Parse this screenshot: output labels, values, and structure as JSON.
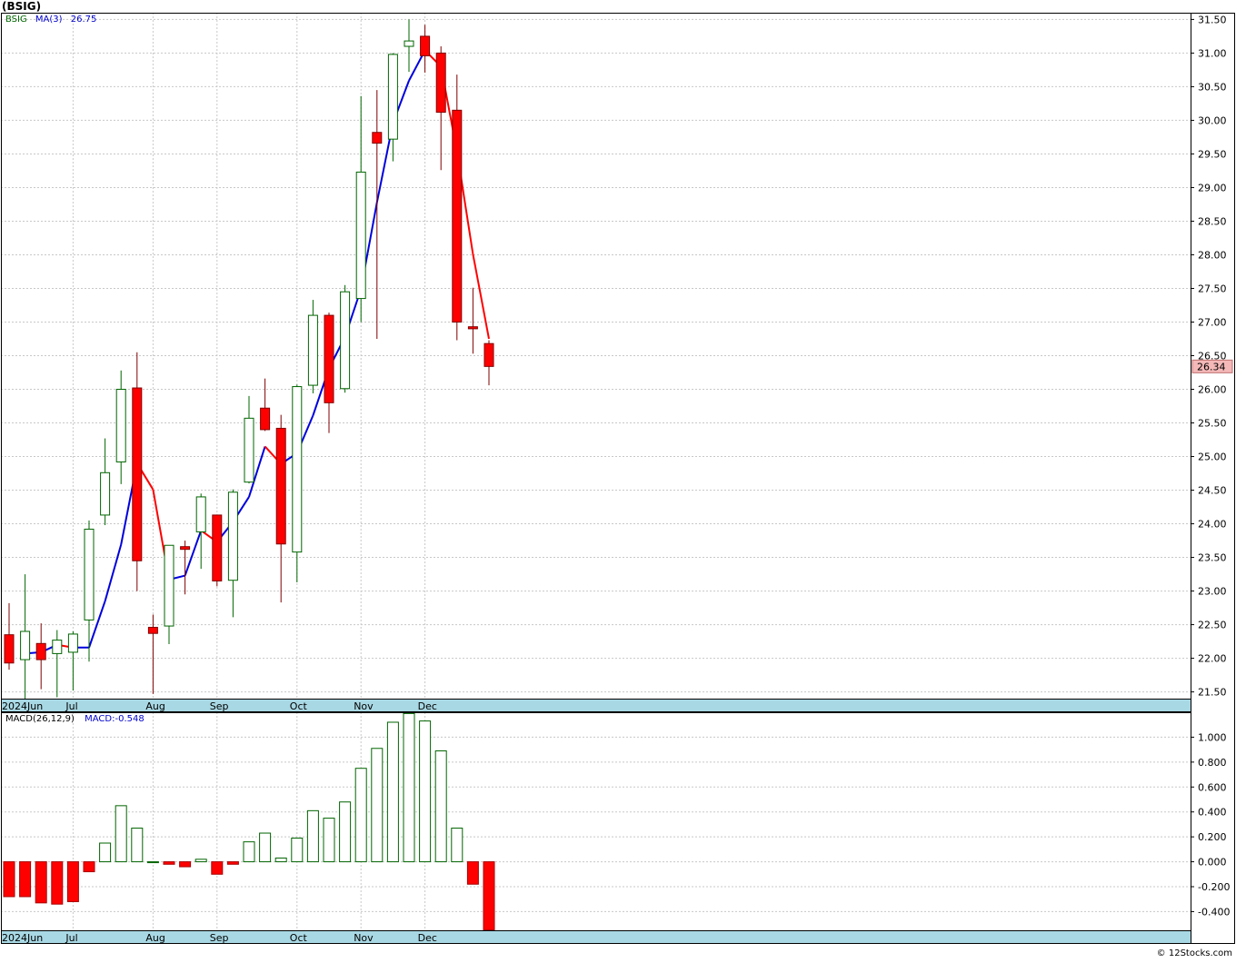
{
  "title": "(BSIG)",
  "legend": {
    "symbol": "BSIG",
    "ma_label": "MA(3)",
    "ma_value": "26.75",
    "macd_label": "MACD(26,12,9)",
    "macd_value": "MACD:-0.548"
  },
  "last_price_label": "26.34",
  "watermark": "© 12Stocks.com",
  "colors": {
    "up": "#006400",
    "down": "#ff0000",
    "ma_up": "#0000dd",
    "ma_down": "#ff0000",
    "axis_band": "#a8d8e4",
    "price_flag_bg": "#f4b8b8"
  },
  "chart_data": [
    {
      "type": "candlestick",
      "name": "price",
      "ylim": [
        21.4,
        31.6
      ],
      "yticks": [
        "21.50",
        "22.00",
        "22.50",
        "23.00",
        "23.50",
        "24.00",
        "24.50",
        "25.00",
        "25.50",
        "26.00",
        "26.50",
        "27.00",
        "27.50",
        "28.00",
        "28.50",
        "29.00",
        "29.50",
        "30.00",
        "30.50",
        "31.00",
        "31.50"
      ],
      "x_labels": [
        "2024Jun",
        "Jul",
        "Aug",
        "Sep",
        "Oct",
        "Nov",
        "Dec"
      ],
      "x_label_weeks": [
        0,
        4,
        9,
        13,
        18,
        22,
        26
      ],
      "candles": [
        {
          "o": 22.35,
          "h": 22.82,
          "l": 21.83,
          "c": 21.93
        },
        {
          "o": 21.98,
          "h": 23.25,
          "l": 21.4,
          "c": 22.4
        },
        {
          "o": 22.22,
          "h": 22.52,
          "l": 21.54,
          "c": 21.98
        },
        {
          "o": 22.07,
          "h": 22.42,
          "l": 21.42,
          "c": 22.27
        },
        {
          "o": 22.09,
          "h": 22.4,
          "l": 21.52,
          "c": 22.36
        },
        {
          "o": 22.57,
          "h": 24.05,
          "l": 21.95,
          "c": 23.92
        },
        {
          "o": 24.13,
          "h": 25.27,
          "l": 23.98,
          "c": 24.76
        },
        {
          "o": 24.92,
          "h": 26.28,
          "l": 24.59,
          "c": 26.0
        },
        {
          "o": 26.02,
          "h": 26.55,
          "l": 23.0,
          "c": 23.45
        },
        {
          "o": 22.46,
          "h": 22.65,
          "l": 21.47,
          "c": 22.37
        },
        {
          "o": 22.48,
          "h": 23.68,
          "l": 22.21,
          "c": 23.68
        },
        {
          "o": 23.66,
          "h": 23.75,
          "l": 22.95,
          "c": 23.62
        },
        {
          "o": 23.88,
          "h": 24.45,
          "l": 23.33,
          "c": 24.4
        },
        {
          "o": 24.13,
          "h": 24.13,
          "l": 23.07,
          "c": 23.15
        },
        {
          "o": 23.16,
          "h": 24.51,
          "l": 22.61,
          "c": 24.47
        },
        {
          "o": 24.62,
          "h": 25.9,
          "l": 24.6,
          "c": 25.57
        },
        {
          "o": 25.72,
          "h": 26.16,
          "l": 25.38,
          "c": 25.4
        },
        {
          "o": 25.42,
          "h": 25.62,
          "l": 22.83,
          "c": 23.7
        },
        {
          "o": 23.58,
          "h": 26.07,
          "l": 23.13,
          "c": 26.04
        },
        {
          "o": 26.06,
          "h": 27.33,
          "l": 25.94,
          "c": 27.1
        },
        {
          "o": 27.1,
          "h": 27.14,
          "l": 25.35,
          "c": 25.8
        },
        {
          "o": 26.01,
          "h": 27.55,
          "l": 25.95,
          "c": 27.45
        },
        {
          "o": 27.35,
          "h": 30.36,
          "l": 27.0,
          "c": 29.23
        },
        {
          "o": 29.82,
          "h": 30.45,
          "l": 26.75,
          "c": 29.66
        },
        {
          "o": 29.72,
          "h": 31.0,
          "l": 29.39,
          "c": 30.98
        },
        {
          "o": 31.1,
          "h": 31.5,
          "l": 30.72,
          "c": 31.18
        },
        {
          "o": 31.25,
          "h": 31.42,
          "l": 30.71,
          "c": 30.96
        },
        {
          "o": 31.0,
          "h": 31.1,
          "l": 29.26,
          "c": 30.12
        },
        {
          "o": 30.15,
          "h": 30.68,
          "l": 26.73,
          "c": 27.0
        },
        {
          "o": 26.93,
          "h": 27.51,
          "l": 26.53,
          "c": 26.9
        },
        {
          "o": 26.68,
          "h": 26.73,
          "l": 26.06,
          "c": 26.34
        }
      ],
      "ma3": [
        null,
        22.07,
        22.09,
        22.2,
        22.16,
        22.16,
        22.85,
        23.69,
        24.9,
        24.51,
        23.17,
        23.23,
        23.9,
        23.73,
        24.03,
        24.4,
        25.15,
        24.89,
        25.05,
        25.61,
        26.31,
        26.78,
        27.49,
        28.78,
        29.96,
        30.59,
        31.04,
        30.8,
        29.54,
        28.01,
        26.75
      ]
    },
    {
      "type": "bar",
      "name": "MACD",
      "ylim": [
        -0.55,
        1.2
      ],
      "yticks": [
        "-0.400",
        "-0.200",
        "0.000",
        "0.200",
        "0.400",
        "0.600",
        "0.800",
        "1.000"
      ],
      "x_labels": [
        "2024Jun",
        "Jul",
        "Aug",
        "Sep",
        "Oct",
        "Nov",
        "Dec"
      ],
      "values": [
        -0.28,
        -0.28,
        -0.33,
        -0.34,
        -0.32,
        -0.08,
        0.15,
        0.45,
        0.27,
        0.0,
        -0.02,
        -0.04,
        0.02,
        -0.1,
        -0.02,
        0.16,
        0.23,
        0.03,
        0.19,
        0.41,
        0.35,
        0.48,
        0.75,
        0.91,
        1.12,
        1.19,
        1.13,
        0.89,
        0.27,
        -0.18,
        -0.548
      ]
    }
  ]
}
